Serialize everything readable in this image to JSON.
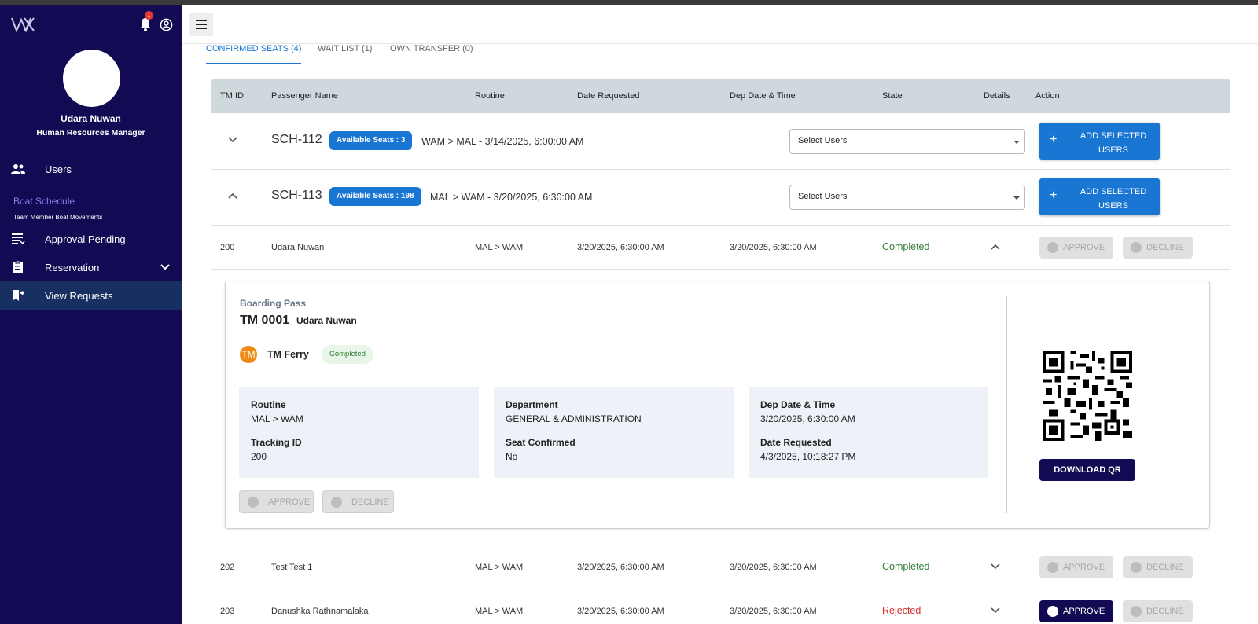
{
  "sidebar": {
    "notification_count": "1",
    "user_name": "Udara Nuwan",
    "user_role": "Human Resources Manager",
    "items": [
      {
        "label": "Users",
        "icon": "people-icon"
      },
      {
        "label": "Approval Pending",
        "icon": "list-icon"
      },
      {
        "label": "Reservation",
        "icon": "clipboard-icon"
      },
      {
        "label": "View Requests",
        "icon": "bookmark-add-icon"
      }
    ],
    "section_title": "Boat Schedule",
    "section_subtitle": "Team Member Boat Movements"
  },
  "tabs": [
    {
      "label": "CONFIRMED SEATS (4)",
      "active": true
    },
    {
      "label": "WAIT LIST (1)",
      "active": false
    },
    {
      "label": "OWN TRANSFER (0)",
      "active": false
    }
  ],
  "table": {
    "headers": [
      "TM ID",
      "Passenger Name",
      "Routine",
      "Date Requested",
      "Dep Date & Time",
      "State",
      "Details",
      "Action"
    ],
    "groups": [
      {
        "schedule": "SCH-112",
        "seats_badge": "Available Seats : 3",
        "route": "WAM > MAL - 3/14/2025, 6:00:00 AM",
        "select_placeholder": "Select Users",
        "add_button": "ADD SELECTED USERS"
      },
      {
        "schedule": "SCH-113",
        "seats_badge": "Available Seats : 198",
        "route": "MAL > WAM - 3/20/2025, 6:30:00 AM",
        "select_placeholder": "Select Users",
        "add_button": "ADD SELECTED USERS"
      }
    ],
    "rows": [
      {
        "tm_id": "200",
        "name": "Udara Nuwan",
        "route": "MAL > WAM",
        "date_requested": "3/20/2025, 6:30:00 AM",
        "dep": "3/20/2025, 6:30:00 AM",
        "state": "Completed"
      },
      {
        "tm_id": "202",
        "name": "Test Test 1",
        "route": "MAL > WAM",
        "date_requested": "3/20/2025, 6:30:00 AM",
        "dep": "3/20/2025, 6:30:00 AM",
        "state": "Completed"
      },
      {
        "tm_id": "203",
        "name": "Danushka Rathnamalaka",
        "route": "MAL > WAM",
        "date_requested": "3/20/2025, 6:30:00 AM",
        "dep": "3/20/2025, 6:30:00 AM",
        "state": "Rejected"
      }
    ],
    "approve_label": "APPROVE",
    "decline_label": "DECLINE"
  },
  "boarding_pass": {
    "title": "Boarding Pass",
    "tm_number": "TM 0001",
    "passenger": "Udara Nuwan",
    "avatar_text": "TM",
    "vessel": "TM Ferry",
    "status": "Completed",
    "fields": {
      "routine_label": "Routine",
      "routine": "MAL > WAM",
      "tracking_label": "Tracking ID",
      "tracking": "200",
      "department_label": "Department",
      "department": "GENERAL & ADMINISTRATION",
      "seat_label": "Seat Confirmed",
      "seat": "No",
      "dep_label": "Dep Date & Time",
      "dep": "3/20/2025, 6:30:00 AM",
      "requested_label": "Date Requested",
      "requested": "4/3/2025, 10:18:27 PM"
    },
    "approve_label": "APPROVE",
    "decline_label": "DECLINE",
    "download_label": "DOWNLOAD QR"
  },
  "colors": {
    "sidebar_bg": "#120a52",
    "primary": "#1976d2",
    "success": "#2e7d32",
    "danger": "#d32f2f"
  }
}
